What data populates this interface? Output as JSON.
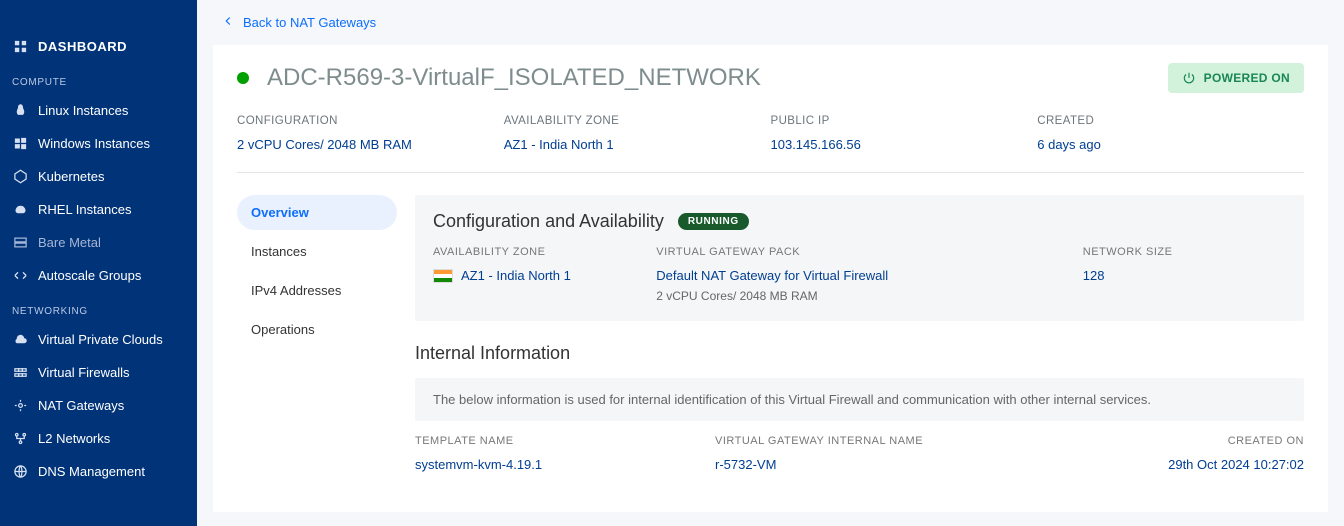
{
  "sidebar": {
    "dashboard": "DASHBOARD",
    "section_compute": "COMPUTE",
    "items_compute": [
      {
        "label": "Linux Instances"
      },
      {
        "label": "Windows Instances"
      },
      {
        "label": "Kubernetes"
      },
      {
        "label": "RHEL Instances"
      },
      {
        "label": "Bare Metal"
      },
      {
        "label": "Autoscale Groups"
      }
    ],
    "section_networking": "NETWORKING",
    "items_networking": [
      {
        "label": "Virtual Private Clouds"
      },
      {
        "label": "Virtual Firewalls"
      },
      {
        "label": "NAT Gateways"
      },
      {
        "label": "L2 Networks"
      },
      {
        "label": "DNS Management"
      }
    ]
  },
  "back_link": "Back to NAT Gateways",
  "status": {
    "color": "#00a000",
    "title": "ADC-R569-3-VirtualF_ISOLATED_NETWORK",
    "power_label": "POWERED ON"
  },
  "summary": {
    "configuration": {
      "label": "CONFIGURATION",
      "value": "2 vCPU Cores/ 2048 MB RAM"
    },
    "az": {
      "label": "AVAILABILITY ZONE",
      "value": "AZ1 - India North 1"
    },
    "public_ip": {
      "label": "PUBLIC IP",
      "value": "103.145.166.56"
    },
    "created": {
      "label": "CREATED",
      "value": "6 days ago"
    }
  },
  "tabs": {
    "overview": "Overview",
    "instances": "Instances",
    "ipv4": "IPv4 Addresses",
    "operations": "Operations"
  },
  "config_section": {
    "title": "Configuration and Availability",
    "badge": "RUNNING",
    "az_label": "AVAILABILITY ZONE",
    "az_value": "AZ1 - India North 1",
    "pack_label": "VIRTUAL GATEWAY PACK",
    "pack_value": "Default NAT Gateway for Virtual Firewall",
    "pack_sub": "2 vCPU Cores/ 2048 MB RAM",
    "size_label": "NETWORK SIZE",
    "size_value": "128"
  },
  "internal_section": {
    "title": "Internal Information",
    "note": "The below information is used for internal identification of this Virtual Firewall and communication with other internal services.",
    "template_label": "TEMPLATE NAME",
    "template_value": "systemvm-kvm-4.19.1",
    "gw_label": "VIRTUAL GATEWAY INTERNAL NAME",
    "gw_value": "r-5732-VM",
    "created_label": "CREATED ON",
    "created_value": "29th Oct 2024 10:27:02"
  }
}
